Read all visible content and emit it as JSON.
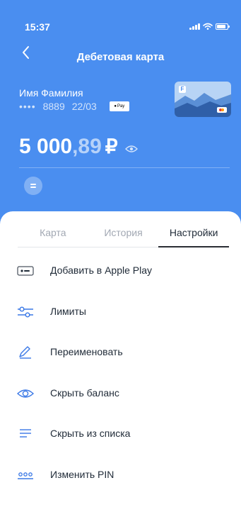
{
  "status_bar": {
    "time": "15:37"
  },
  "header": {
    "title": "Дебетовая карта"
  },
  "card": {
    "holder": "Имя Фамилия",
    "mask": "••••",
    "last4": "8889",
    "expiry": "22/03",
    "pay_badge": "Pay",
    "logo_letter": "F"
  },
  "balance": {
    "whole": "5 000",
    "fraction": ",89",
    "currency": "₽"
  },
  "tabs": [
    {
      "label": "Карта"
    },
    {
      "label": "История"
    },
    {
      "label": "Настройки"
    }
  ],
  "menu": {
    "add_apple_pay": "Добавить в Apple Play",
    "limits": "Лимиты",
    "rename": "Переименовать",
    "hide_balance": "Скрыть баланс",
    "hide_from_list": "Скрыть из списка",
    "change_pin": "Изменить PIN"
  },
  "colors": {
    "primary": "#4a8ef0",
    "icon_blue": "#3a78e6",
    "text": "#1f2a37",
    "muted": "#a2a8b3"
  }
}
